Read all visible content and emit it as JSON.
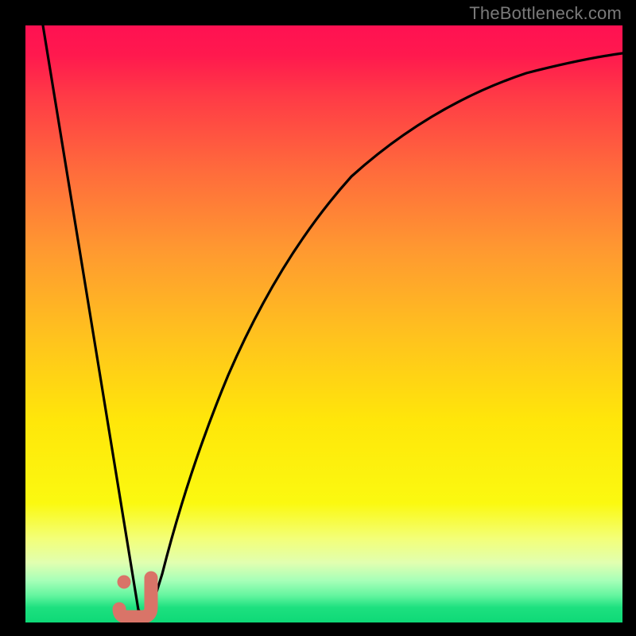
{
  "attribution": "TheBottleneck.com",
  "colors": {
    "frame": "#000000",
    "curve": "#000000",
    "marker": "#d97468",
    "gradient_top": "#ff1152",
    "gradient_bottom": "#0ed977"
  },
  "chart_data": {
    "type": "line",
    "title": "",
    "xlabel": "",
    "ylabel": "",
    "xlim": [
      0,
      100
    ],
    "ylim": [
      0,
      100
    ],
    "grid": false,
    "legend": false,
    "series": [
      {
        "name": "left-branch",
        "x": [
          3,
          5,
          7,
          9,
          11,
          13,
          15,
          16.5,
          18,
          19
        ],
        "y": [
          100,
          88,
          76,
          64,
          52,
          40,
          26,
          14,
          5,
          1
        ]
      },
      {
        "name": "right-branch",
        "x": [
          21,
          22,
          23.5,
          25,
          28,
          32,
          37,
          43,
          50,
          58,
          67,
          77,
          88,
          100
        ],
        "y": [
          1,
          5,
          14,
          26,
          42,
          56,
          67,
          75,
          81,
          85.5,
          89,
          91.5,
          93.3,
          94.7
        ]
      }
    ],
    "annotations": [
      {
        "name": "marker-j",
        "shape": "J",
        "approx_x": 19.5,
        "approx_y": 2.5,
        "color": "#d97468"
      },
      {
        "name": "marker-dot",
        "shape": "dot",
        "approx_x": 16.7,
        "approx_y": 6.2,
        "color": "#d97468"
      }
    ]
  }
}
